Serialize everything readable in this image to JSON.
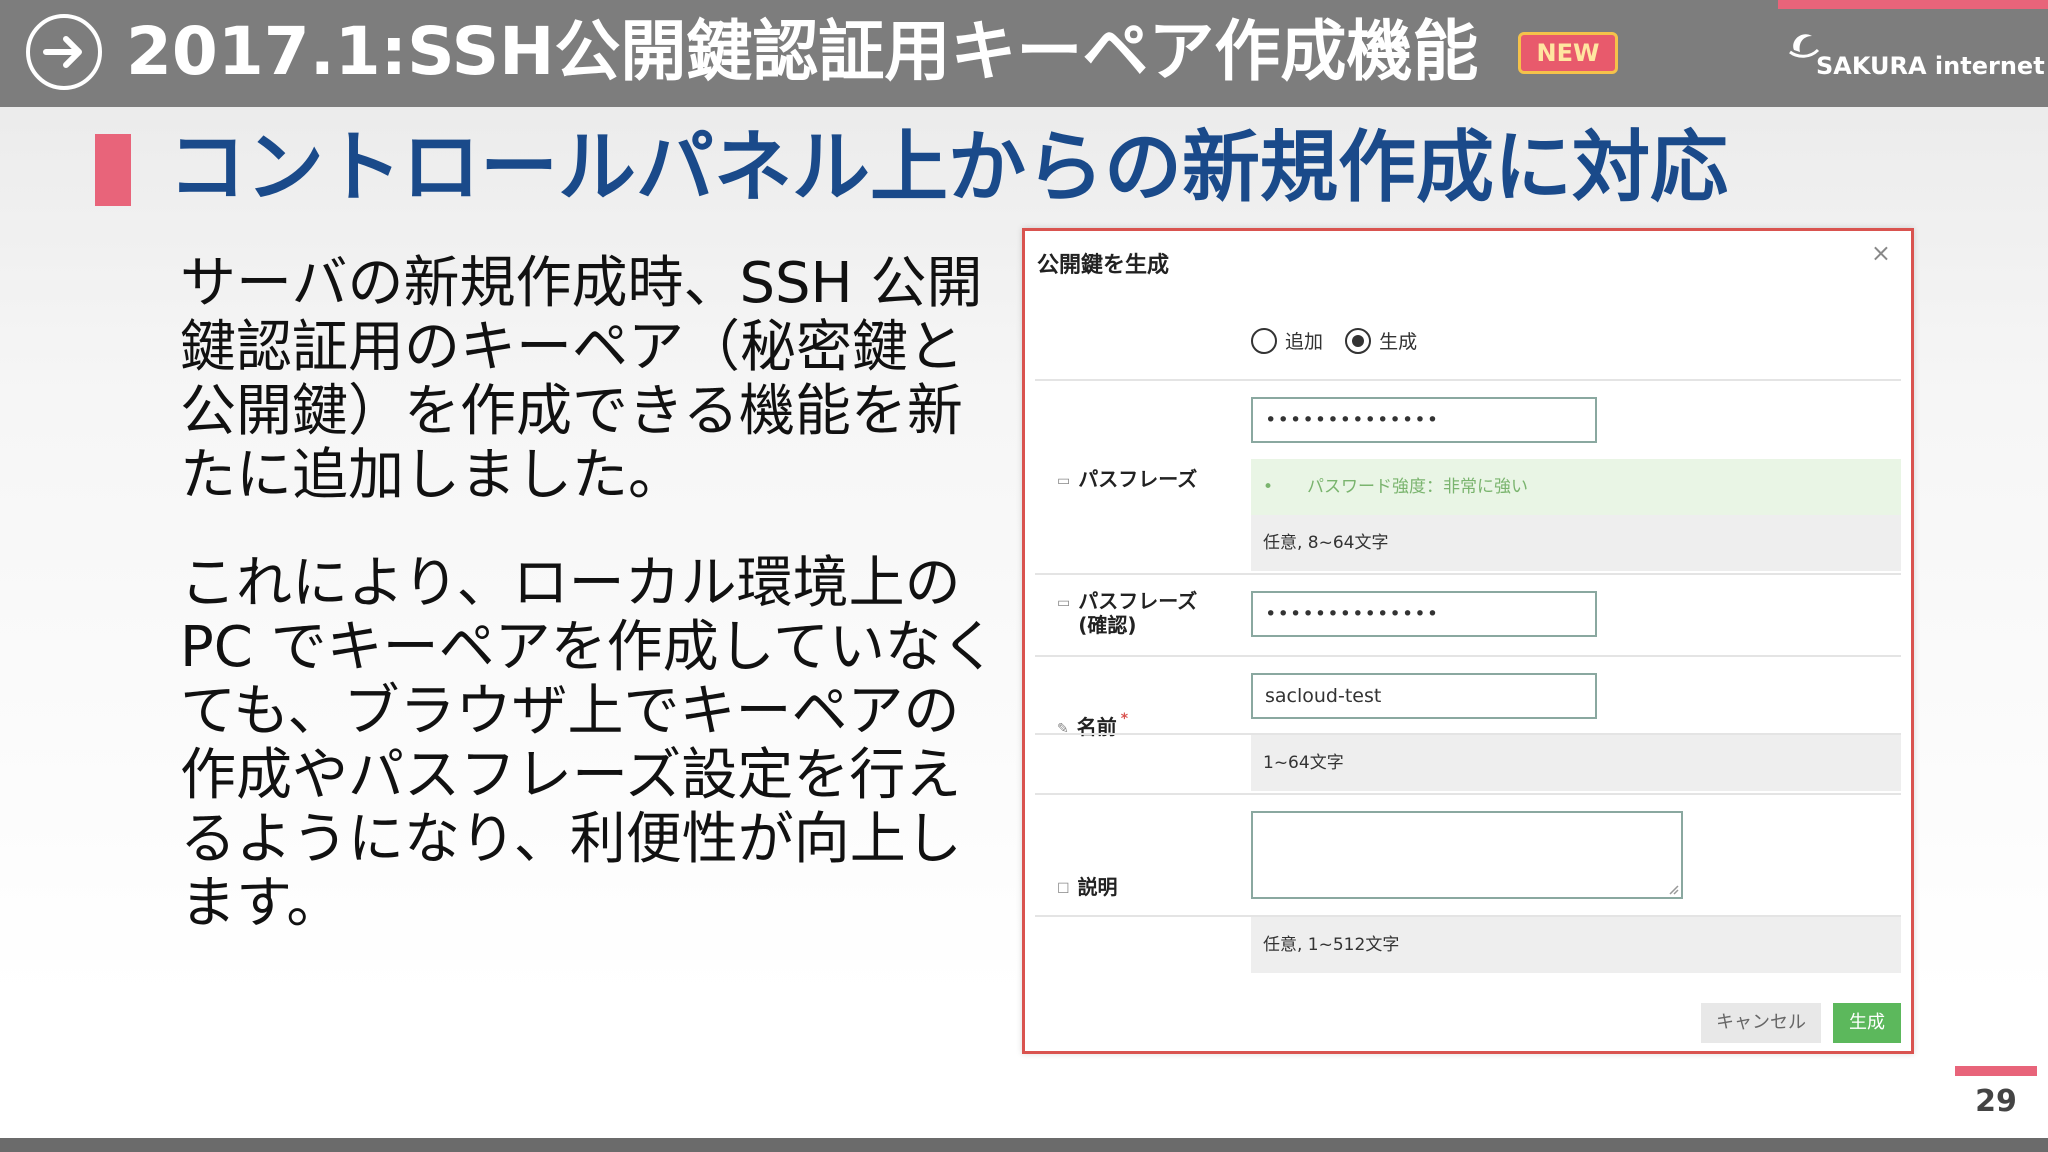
{
  "header": {
    "title": "2017.1:SSH公開鍵認証用キーペア作成機能",
    "badge": "NEW",
    "brand": "SAKURA internet"
  },
  "subtitle": "コントロールパネル上からの新規作成に対応",
  "body": {
    "paragraph1": "サーバの新規作成時、SSH 公開鍵認証用のキーペア（秘密鍵と公開鍵）を作成できる機能を新たに追加しました。",
    "paragraph2": "これにより、ローカル環境上の PC でキーペアを作成していなくても、ブラウザ上でキーペアの作成やパスフレーズ設定を行えるようになり、利便性が向上します。"
  },
  "dialog": {
    "title": "公開鍵を生成",
    "close": "×",
    "radio_add": "追加",
    "radio_generate": "生成",
    "passphrase_label": "パスフレーズ",
    "passphrase_value": "••••••••••••••",
    "strength_text": "•　　パスワード強度：非常に強い",
    "passphrase_hint": "任意, 8~64文字",
    "confirm_label": "パスフレーズ(確認)",
    "confirm_value": "••••••••••••••",
    "name_label": "名前",
    "name_required": "*",
    "name_value": "sacloud-test",
    "name_hint": "1~64文字",
    "description_label": "説明",
    "description_hint": "任意, 1~512文字",
    "cancel_button": "キャンセル",
    "create_button": "生成"
  },
  "page_number": "29",
  "colors": {
    "header_bg": "#7d7d7d",
    "accent": "#e8647a",
    "subtitle": "#1a4a8a",
    "dialog_border": "#d9534f",
    "create_button": "#5cb85c"
  }
}
